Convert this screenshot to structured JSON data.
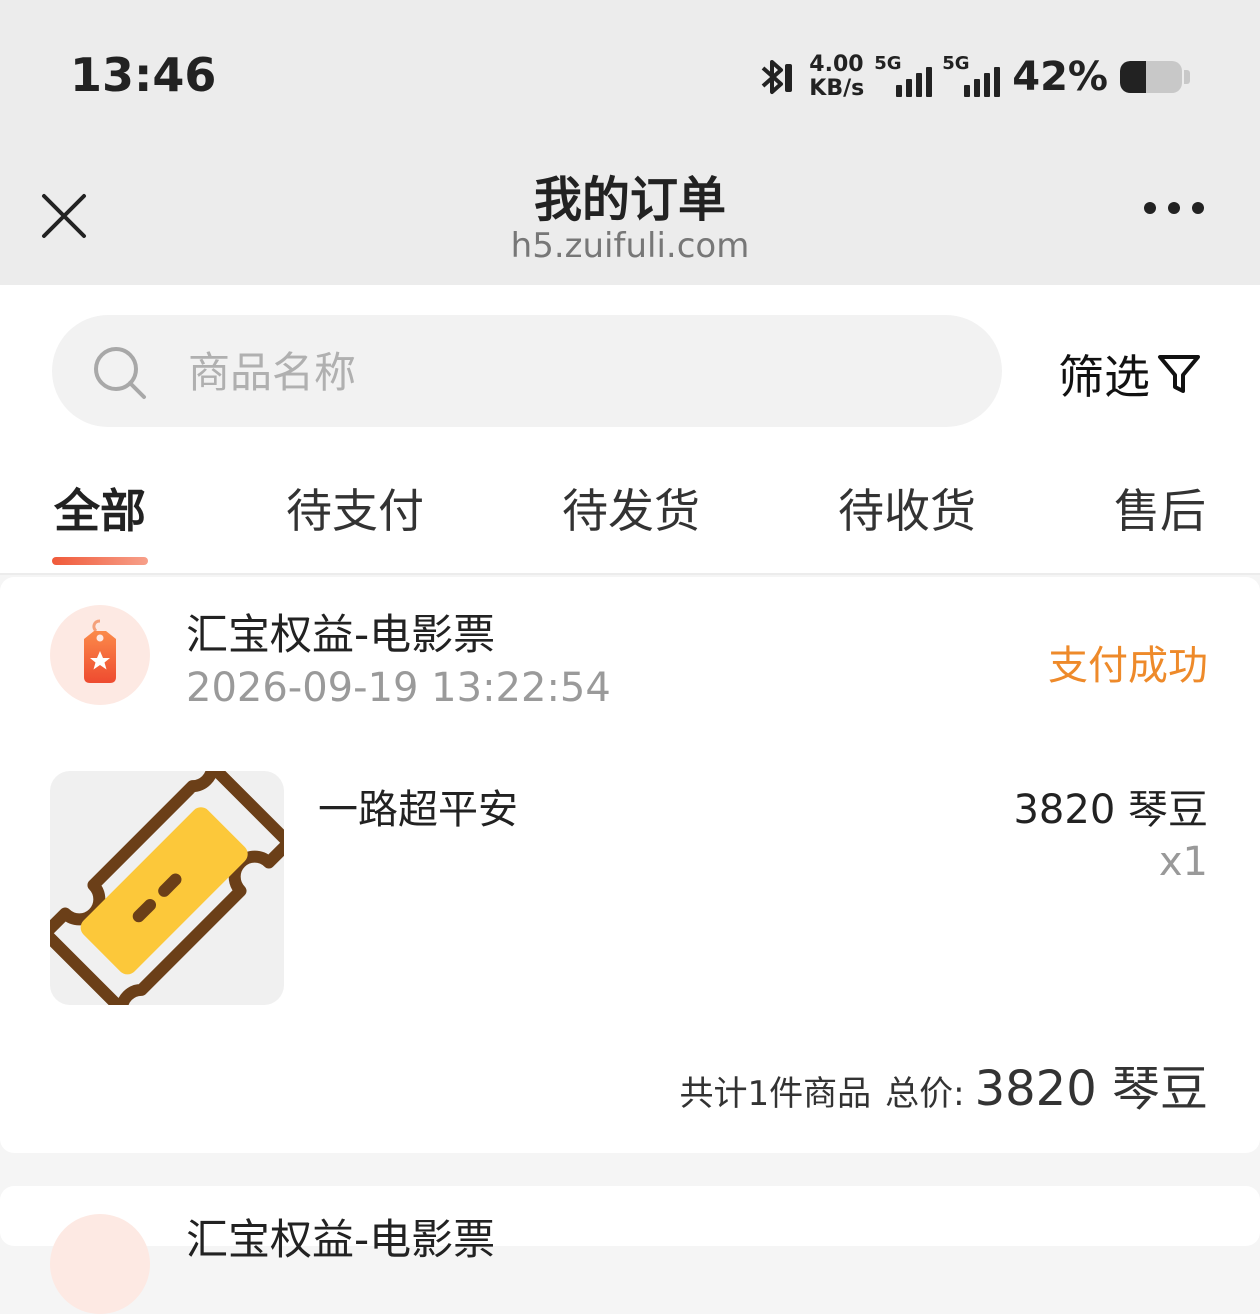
{
  "status_bar": {
    "time": "13:46",
    "net_speed_value": "4.00",
    "net_speed_unit": "KB/s",
    "signal1_label": "5G",
    "signal2_label": "5G",
    "battery_percent": "42%",
    "battery_level": 0.42
  },
  "nav": {
    "title": "我的订单",
    "subtitle": "h5.zuifuli.com"
  },
  "search": {
    "placeholder": "商品名称",
    "value": ""
  },
  "filter": {
    "label": "筛选"
  },
  "tabs": [
    {
      "label": "全部",
      "active": true
    },
    {
      "label": "待支付",
      "active": false
    },
    {
      "label": "待发货",
      "active": false
    },
    {
      "label": "待收货",
      "active": false
    },
    {
      "label": "售后",
      "active": false
    }
  ],
  "orders": [
    {
      "shop_name": "汇宝权益-电影票",
      "time": "2026-09-19 13:22:54",
      "status": "支付成功",
      "product_name": "一路超平安",
      "product_price": "3820 琴豆",
      "product_qty": "x1",
      "summary_count": "共计1件商品",
      "summary_label": "总价:",
      "summary_total": "3820 琴豆"
    },
    {
      "shop_name": "汇宝权益-电影票"
    }
  ],
  "colors": {
    "accent": "#f05a3a",
    "status_success": "#ee8a2a",
    "nav_bg": "#ececec"
  }
}
